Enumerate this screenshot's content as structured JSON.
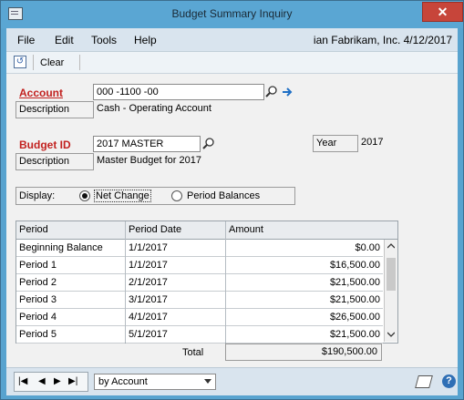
{
  "window": {
    "title": "Budget Summary Inquiry",
    "close_label": "✕"
  },
  "menu": {
    "items": [
      "File",
      "Edit",
      "Tools",
      "Help"
    ],
    "company": "ian  Fabrikam, Inc.  4/12/2017"
  },
  "toolbar": {
    "clear_label": "Clear"
  },
  "account": {
    "label": "Account",
    "value": "000 -1100 -00",
    "description_label": "Description",
    "description_value": "Cash - Operating Account"
  },
  "budget": {
    "label": "Budget ID",
    "value": "2017 MASTER",
    "description_label": "Description",
    "description_value": "Master Budget for 2017",
    "year_label": "Year",
    "year_value": "2017"
  },
  "display": {
    "label": "Display:",
    "options": [
      "Net Change",
      "Period Balances"
    ],
    "selected": "Net Change"
  },
  "table": {
    "headers": [
      "Period",
      "Period Date",
      "Amount"
    ],
    "rows": [
      {
        "period": "Beginning Balance",
        "date": "1/1/2017",
        "amount": "$0.00"
      },
      {
        "period": "Period 1",
        "date": "1/1/2017",
        "amount": "$16,500.00"
      },
      {
        "period": "Period 2",
        "date": "2/1/2017",
        "amount": "$21,500.00"
      },
      {
        "period": "Period 3",
        "date": "3/1/2017",
        "amount": "$21,500.00"
      },
      {
        "period": "Period 4",
        "date": "4/1/2017",
        "amount": "$26,500.00"
      },
      {
        "period": "Period 5",
        "date": "5/1/2017",
        "amount": "$21,500.00"
      }
    ],
    "total_label": "Total",
    "total_value": "$190,500.00"
  },
  "footer": {
    "sort_value": "by Account",
    "help_label": "?"
  },
  "colors": {
    "titlebar": "#5aa6d3",
    "required_label": "#c2211f",
    "close": "#c7453a"
  },
  "icons": [
    "app-icon",
    "close-icon",
    "clear-icon",
    "lookup-icon",
    "arrow-right-icon",
    "first-icon",
    "prev-icon",
    "next-icon",
    "last-icon",
    "note-icon",
    "help-icon"
  ]
}
